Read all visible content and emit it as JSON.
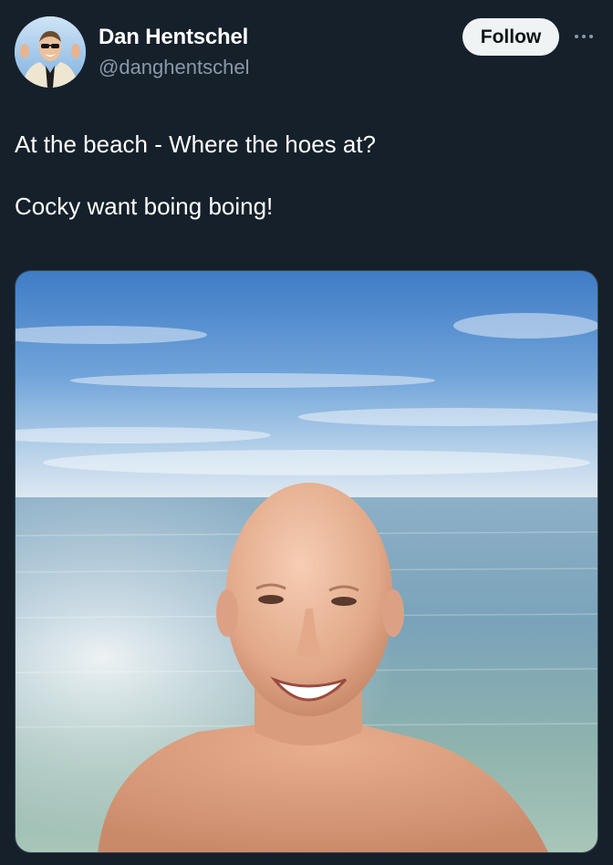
{
  "author": {
    "display_name": "Dan Hentschel",
    "handle": "@danghentschel",
    "avatar_icon": "profile-avatar"
  },
  "actions": {
    "follow_label": "Follow",
    "more_icon": "more-horizontal-icon"
  },
  "tweet": {
    "lines": [
      "At the beach - Where the hoes at?",
      "Cocky want boing boing!"
    ]
  },
  "media": {
    "type": "photo",
    "subject": "beach selfie"
  },
  "colors": {
    "background": "#15202b",
    "text_primary": "#ffffff",
    "text_secondary": "#8b98a5",
    "follow_bg": "#eff3f4",
    "follow_text": "#0f1419"
  }
}
